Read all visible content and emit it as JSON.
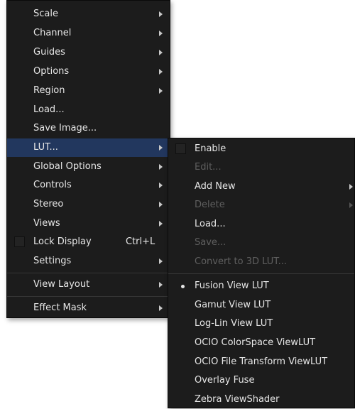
{
  "main_menu": {
    "items": [
      {
        "label": "Scale"
      },
      {
        "label": "Channel"
      },
      {
        "label": "Guides"
      },
      {
        "label": "Options"
      },
      {
        "label": "Region"
      },
      {
        "label": "Load..."
      },
      {
        "label": "Save Image..."
      },
      {
        "label": "LUT..."
      },
      {
        "label": "Global Options"
      },
      {
        "label": "Controls"
      },
      {
        "label": "Stereo"
      },
      {
        "label": "Views"
      },
      {
        "label": "Lock Display",
        "shortcut": "Ctrl+L"
      },
      {
        "label": "Settings"
      },
      {
        "label": "View Layout"
      },
      {
        "label": "Effect Mask"
      }
    ]
  },
  "lut_submenu": {
    "items": [
      {
        "label": "Enable"
      },
      {
        "label": "Edit..."
      },
      {
        "label": "Add New"
      },
      {
        "label": "Delete"
      },
      {
        "label": "Load..."
      },
      {
        "label": "Save..."
      },
      {
        "label": "Convert to 3D LUT..."
      },
      {
        "label": "Fusion View LUT"
      },
      {
        "label": "Gamut View LUT"
      },
      {
        "label": "Log-Lin View LUT"
      },
      {
        "label": "OCIO ColorSpace ViewLUT"
      },
      {
        "label": "OCIO File Transform ViewLUT"
      },
      {
        "label": "Overlay Fuse"
      },
      {
        "label": "Zebra ViewShader"
      }
    ]
  },
  "colors": {
    "menu_bg": "#1c1c1c",
    "highlight": "#22375e",
    "text": "#e6e6e6",
    "disabled_text": "#5f5f5f"
  }
}
